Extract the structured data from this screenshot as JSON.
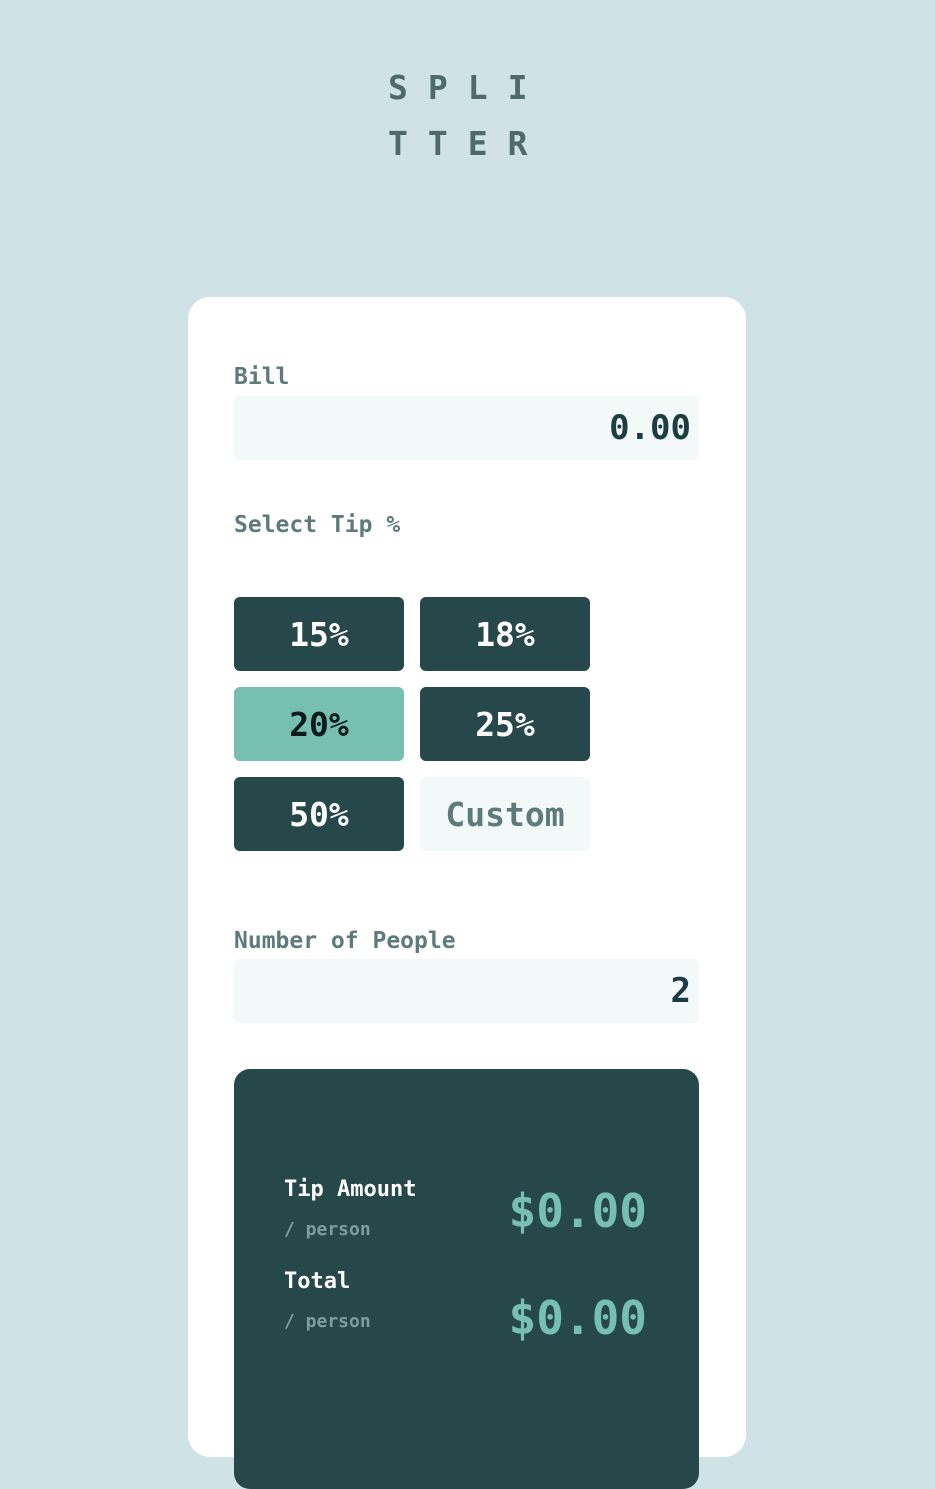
{
  "logo": {
    "line1": "SPLI",
    "line2": "TTER"
  },
  "bill": {
    "label": "Bill",
    "value": "0.00"
  },
  "tip": {
    "label": "Select Tip %",
    "options": [
      "15%",
      "18%",
      "20%",
      "25%",
      "50%"
    ],
    "selected": "20%",
    "custom_placeholder": "Custom"
  },
  "people": {
    "label": "Number of People",
    "value": "2"
  },
  "results": {
    "tip_amount_label": "Tip Amount",
    "tip_amount_sub": "/ person",
    "tip_amount_value": "$0.00",
    "total_label": "Total",
    "total_sub": "/ person",
    "total_value": "$0.00"
  },
  "colors": {
    "background": "#cfe2e6",
    "dark_teal": "#27484b",
    "accent": "#77bfb0",
    "input_bg": "#f3f8f9"
  }
}
